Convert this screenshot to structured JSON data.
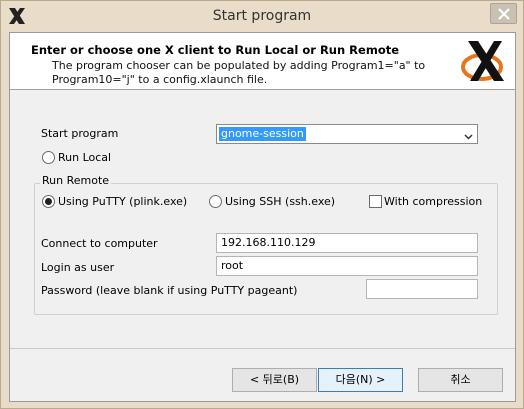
{
  "window": {
    "title": "Start program"
  },
  "header": {
    "title": "Enter or choose one X client to Run Local or Run Remote",
    "description": "The program chooser can be populated by adding Program1=\"a\" to Program10=\"j\" to a config.xlaunch file."
  },
  "form": {
    "start_program_label": "Start program",
    "start_program_value": "gnome-session",
    "run_local_label": "Run Local",
    "run_remote_label": "Run Remote",
    "using_putty_label": "Using PuTTY (plink.exe)",
    "using_ssh_label": "Using SSH (ssh.exe)",
    "with_compression_label": "With compression",
    "connect_label": "Connect to computer",
    "connect_value": "192.168.110.129",
    "login_label": "Login as user",
    "login_value": "root",
    "password_label": "Password (leave blank if using PuTTY pageant)",
    "password_value": ""
  },
  "state": {
    "run_mode": "remote",
    "remote_method": "putty",
    "with_compression": false
  },
  "buttons": {
    "back": "< 뒤로(B)",
    "next": "다음(N) >",
    "cancel": "취소"
  },
  "colors": {
    "accent": "#3399ff",
    "logo_orange": "#e8741c"
  }
}
